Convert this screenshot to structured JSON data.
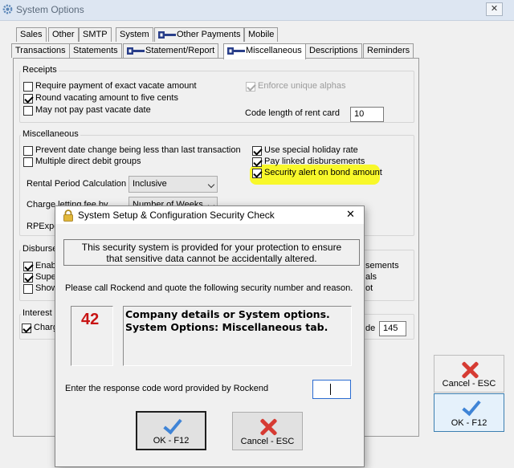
{
  "window": {
    "title": "System Options",
    "close_glyph": "✕"
  },
  "tabs_row1": [
    "Sales",
    "Other",
    "SMTP",
    "System",
    "Other Payments",
    "Mobile"
  ],
  "tabs_row2": [
    "Transactions",
    "Statements",
    "Statement/Report",
    "Miscellaneous",
    "Descriptions",
    "Reminders"
  ],
  "active_tab": "Miscellaneous",
  "receipts": {
    "title": "Receipts",
    "require_exact": {
      "label": "Require payment of exact vacate amount",
      "checked": false
    },
    "round_vacating": {
      "label": "Round vacating amount to five cents",
      "checked": true
    },
    "no_pay_past": {
      "label": "May not pay past vacate date",
      "checked": false
    },
    "enforce_alphas": {
      "label": "Enforce unique alphas",
      "checked": true,
      "enabled": false
    },
    "code_length_label": "Code length of rent card",
    "code_length_value": "10"
  },
  "misc": {
    "title": "Miscellaneous",
    "prevent_date": {
      "label": "Prevent date change being less than last transaction",
      "checked": false
    },
    "multiple_debit": {
      "label": "Multiple direct debit groups",
      "checked": false
    },
    "special_holiday": {
      "label": "Use special holiday rate",
      "checked": true
    },
    "pay_linked": {
      "label": "Pay linked disbursements",
      "checked": true
    },
    "security_alert": {
      "label": "Security alert on bond amount",
      "checked": true,
      "highlight_color": "#f8f82a"
    },
    "rental_period_label": "Rental Period Calculation",
    "rental_period_value": "Inclusive",
    "charge_letting_label": "Charge letting fee by",
    "charge_letting_value": "Number of Weeks",
    "rpexpo_label": "RPExpo"
  },
  "disbursements": {
    "title": "Disburse",
    "enable": {
      "label": "Enabl",
      "checked": true
    },
    "super": {
      "label": "Super",
      "checked": true
    },
    "show": {
      "label": "Show",
      "checked": false
    },
    "right1": "sements",
    "right2": "als",
    "right3": "ot"
  },
  "interest": {
    "title": "Interest o",
    "charge": {
      "label": "Charge",
      "checked": true
    },
    "right_label": "de",
    "right_value": "145"
  },
  "side_buttons": {
    "cancel": "Cancel - ESC",
    "ok": "OK - F12"
  },
  "dialog": {
    "title": "System Setup & Configuration Security Check",
    "close_glyph": "✕",
    "message_line1": "This security system is provided for your protection to ensure",
    "message_line2": "that sensitive data cannot be accidentally altered.",
    "call_text": "Please call Rockend and quote the following security number and reason.",
    "security_number": "42",
    "reason_line1": "Company details or System options.",
    "reason_line2": "System Options: Miscellaneous tab.",
    "response_label": "Enter the response code word provided by Rockend",
    "response_value": "",
    "ok_label": "OK - F12",
    "cancel_label": "Cancel - ESC"
  },
  "colors": {
    "security_number": "#c81414",
    "ok_tick": "#3f84d6",
    "cancel_cross": "#d63b33"
  }
}
